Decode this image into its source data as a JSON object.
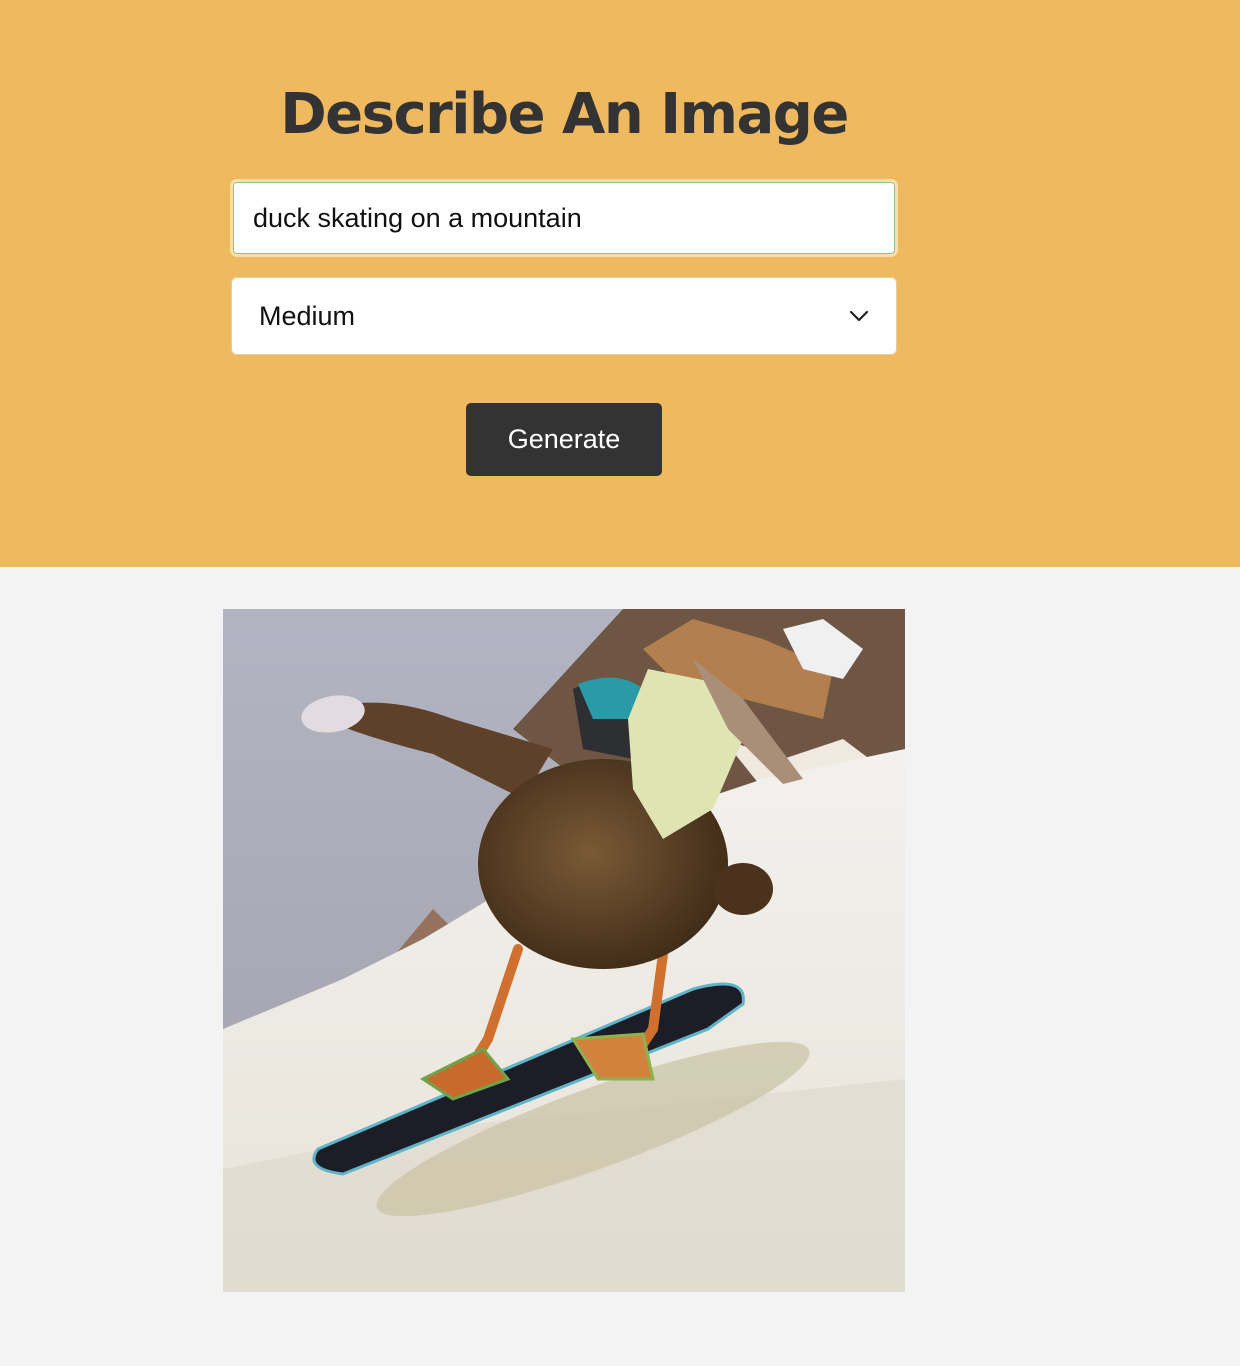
{
  "header": {
    "title": "Describe An Image"
  },
  "form": {
    "prompt_value": "duck skating on a mountain",
    "size_selected": "Medium",
    "generate_label": "Generate"
  },
  "result": {
    "image_alt": "duck skating on a mountain"
  },
  "colors": {
    "hero_background": "#efb960",
    "page_background": "#f3f3f3",
    "title_text": "#333333",
    "button_background": "#333333",
    "button_text": "#ffffff"
  },
  "icons": {
    "select_arrow": "chevron-down-icon"
  }
}
